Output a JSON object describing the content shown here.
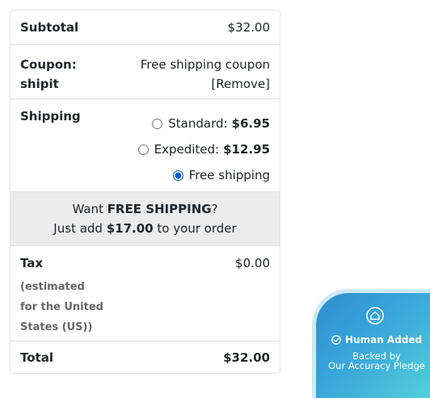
{
  "totals": {
    "subtotal": {
      "label": "Subtotal",
      "value": "$32.00"
    },
    "coupon": {
      "label": "Coupon:",
      "code": "shipit",
      "description": "Free shipping coupon",
      "remove_label": "[Remove]"
    },
    "shipping": {
      "label": "Shipping",
      "options": [
        {
          "name": "Standard:",
          "price": "$6.95",
          "selected": false
        },
        {
          "name": "Expedited:",
          "price": "$12.95",
          "selected": false
        },
        {
          "name": "Free shipping",
          "price": "",
          "selected": true
        }
      ]
    },
    "promo": {
      "line1_prefix": "Want ",
      "line1_strong": "FREE SHIPPING",
      "line1_suffix": "?",
      "line2_prefix": "Just add ",
      "line2_strong": "$17.00",
      "line2_suffix": " to your order"
    },
    "tax": {
      "label": "Tax",
      "note_lines": [
        "(estimated",
        "for the United",
        "States (US))"
      ],
      "value": "$0.00"
    },
    "total": {
      "label": "Total",
      "value": "$32.00"
    }
  },
  "pledge_badge": {
    "icon": "home-icon",
    "title": "Human Added",
    "subtitle_line1": "Backed by",
    "subtitle_line2": "Our Accuracy Pledge",
    "colors": {
      "gradient_start": "#2d8fd1",
      "gradient_end": "#56d6dc"
    }
  }
}
